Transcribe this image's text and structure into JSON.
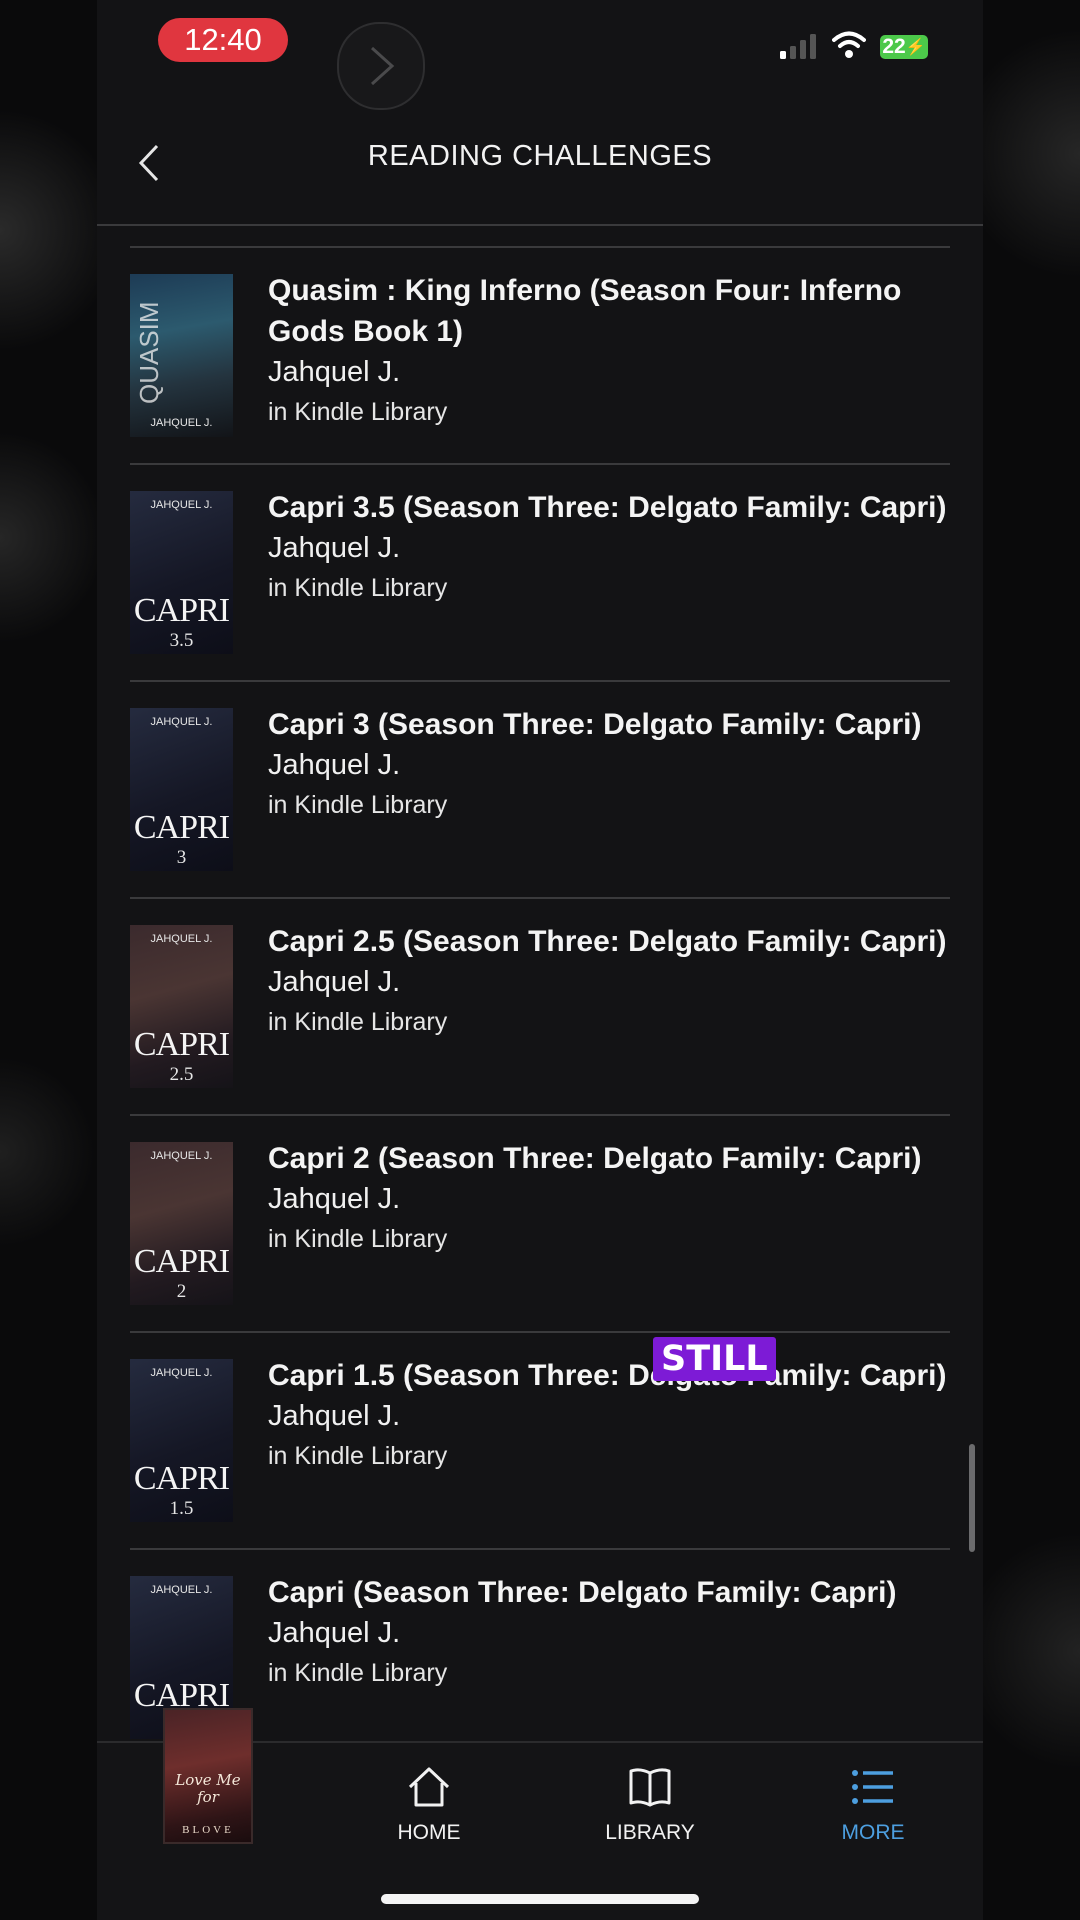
{
  "status_bar": {
    "time": "12:40",
    "battery": "22"
  },
  "header": {
    "title": "READING CHALLENGES"
  },
  "books": [
    {
      "title": "Quasim : King Inferno (Season Four: Inferno Gods Book 1)",
      "author": "Jahquel J.",
      "source": "in Kindle Library",
      "cover_text": "QUASIM",
      "cover_author": "JAHQUEL J.",
      "cover_number": ""
    },
    {
      "title": "Capri 3.5 (Season Three: Delgato Family: Capri)",
      "author": "Jahquel J.",
      "source": "in Kindle Library",
      "cover_text": "CAPRI",
      "cover_author": "JAHQUEL J.",
      "cover_number": "3.5"
    },
    {
      "title": "Capri 3 (Season Three: Delgato Family: Capri)",
      "author": "Jahquel J.",
      "source": "in Kindle Library",
      "cover_text": "CAPRI",
      "cover_author": "JAHQUEL J.",
      "cover_number": "3"
    },
    {
      "title": "Capri 2.5 (Season Three: Delgato Family: Capri)",
      "author": "Jahquel J.",
      "source": "in Kindle Library",
      "cover_text": "CAPRI",
      "cover_author": "JAHQUEL J.",
      "cover_number": "2.5"
    },
    {
      "title": "Capri 2 (Season Three: Delgato Family: Capri)",
      "author": "Jahquel J.",
      "source": "in Kindle Library",
      "cover_text": "CAPRI",
      "cover_author": "JAHQUEL J.",
      "cover_number": "2"
    },
    {
      "title": "Capri 1.5 (Season Three: Delgato Family: Capri)",
      "author": "Jahquel J.",
      "source": "in Kindle Library",
      "cover_text": "CAPRI",
      "cover_author": "JAHQUEL J.",
      "cover_number": "1.5"
    },
    {
      "title": "Capri (Season Three: Delgato Family: Capri)",
      "author": "Jahquel J.",
      "source": "in Kindle Library",
      "cover_text": "CAPRI",
      "cover_author": "JAHQUEL J.",
      "cover_number": ""
    }
  ],
  "caption": "STILL",
  "now_reading": {
    "title": "Love Me for",
    "author": "BLOVE"
  },
  "bottom_nav": {
    "home": "HOME",
    "library": "LIBRARY",
    "more": "MORE"
  },
  "colors": {
    "background": "#131315",
    "accent": "#4d9fe0",
    "time_pill": "#e0363f",
    "caption": "#7d1bd6"
  }
}
